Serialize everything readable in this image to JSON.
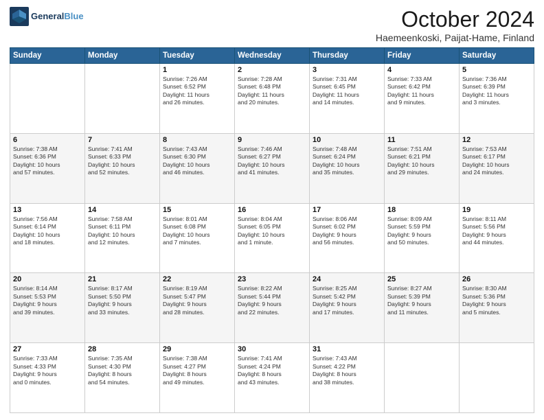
{
  "header": {
    "logo_line1": "General",
    "logo_line2": "Blue",
    "title": "October 2024",
    "subtitle": "Haemeenkoski, Paijat-Hame, Finland"
  },
  "weekdays": [
    "Sunday",
    "Monday",
    "Tuesday",
    "Wednesday",
    "Thursday",
    "Friday",
    "Saturday"
  ],
  "weeks": [
    [
      {
        "day": "",
        "info": ""
      },
      {
        "day": "",
        "info": ""
      },
      {
        "day": "1",
        "info": "Sunrise: 7:26 AM\nSunset: 6:52 PM\nDaylight: 11 hours\nand 26 minutes."
      },
      {
        "day": "2",
        "info": "Sunrise: 7:28 AM\nSunset: 6:48 PM\nDaylight: 11 hours\nand 20 minutes."
      },
      {
        "day": "3",
        "info": "Sunrise: 7:31 AM\nSunset: 6:45 PM\nDaylight: 11 hours\nand 14 minutes."
      },
      {
        "day": "4",
        "info": "Sunrise: 7:33 AM\nSunset: 6:42 PM\nDaylight: 11 hours\nand 9 minutes."
      },
      {
        "day": "5",
        "info": "Sunrise: 7:36 AM\nSunset: 6:39 PM\nDaylight: 11 hours\nand 3 minutes."
      }
    ],
    [
      {
        "day": "6",
        "info": "Sunrise: 7:38 AM\nSunset: 6:36 PM\nDaylight: 10 hours\nand 57 minutes."
      },
      {
        "day": "7",
        "info": "Sunrise: 7:41 AM\nSunset: 6:33 PM\nDaylight: 10 hours\nand 52 minutes."
      },
      {
        "day": "8",
        "info": "Sunrise: 7:43 AM\nSunset: 6:30 PM\nDaylight: 10 hours\nand 46 minutes."
      },
      {
        "day": "9",
        "info": "Sunrise: 7:46 AM\nSunset: 6:27 PM\nDaylight: 10 hours\nand 41 minutes."
      },
      {
        "day": "10",
        "info": "Sunrise: 7:48 AM\nSunset: 6:24 PM\nDaylight: 10 hours\nand 35 minutes."
      },
      {
        "day": "11",
        "info": "Sunrise: 7:51 AM\nSunset: 6:21 PM\nDaylight: 10 hours\nand 29 minutes."
      },
      {
        "day": "12",
        "info": "Sunrise: 7:53 AM\nSunset: 6:17 PM\nDaylight: 10 hours\nand 24 minutes."
      }
    ],
    [
      {
        "day": "13",
        "info": "Sunrise: 7:56 AM\nSunset: 6:14 PM\nDaylight: 10 hours\nand 18 minutes."
      },
      {
        "day": "14",
        "info": "Sunrise: 7:58 AM\nSunset: 6:11 PM\nDaylight: 10 hours\nand 12 minutes."
      },
      {
        "day": "15",
        "info": "Sunrise: 8:01 AM\nSunset: 6:08 PM\nDaylight: 10 hours\nand 7 minutes."
      },
      {
        "day": "16",
        "info": "Sunrise: 8:04 AM\nSunset: 6:05 PM\nDaylight: 10 hours\nand 1 minute."
      },
      {
        "day": "17",
        "info": "Sunrise: 8:06 AM\nSunset: 6:02 PM\nDaylight: 9 hours\nand 56 minutes."
      },
      {
        "day": "18",
        "info": "Sunrise: 8:09 AM\nSunset: 5:59 PM\nDaylight: 9 hours\nand 50 minutes."
      },
      {
        "day": "19",
        "info": "Sunrise: 8:11 AM\nSunset: 5:56 PM\nDaylight: 9 hours\nand 44 minutes."
      }
    ],
    [
      {
        "day": "20",
        "info": "Sunrise: 8:14 AM\nSunset: 5:53 PM\nDaylight: 9 hours\nand 39 minutes."
      },
      {
        "day": "21",
        "info": "Sunrise: 8:17 AM\nSunset: 5:50 PM\nDaylight: 9 hours\nand 33 minutes."
      },
      {
        "day": "22",
        "info": "Sunrise: 8:19 AM\nSunset: 5:47 PM\nDaylight: 9 hours\nand 28 minutes."
      },
      {
        "day": "23",
        "info": "Sunrise: 8:22 AM\nSunset: 5:44 PM\nDaylight: 9 hours\nand 22 minutes."
      },
      {
        "day": "24",
        "info": "Sunrise: 8:25 AM\nSunset: 5:42 PM\nDaylight: 9 hours\nand 17 minutes."
      },
      {
        "day": "25",
        "info": "Sunrise: 8:27 AM\nSunset: 5:39 PM\nDaylight: 9 hours\nand 11 minutes."
      },
      {
        "day": "26",
        "info": "Sunrise: 8:30 AM\nSunset: 5:36 PM\nDaylight: 9 hours\nand 5 minutes."
      }
    ],
    [
      {
        "day": "27",
        "info": "Sunrise: 7:33 AM\nSunset: 4:33 PM\nDaylight: 9 hours\nand 0 minutes."
      },
      {
        "day": "28",
        "info": "Sunrise: 7:35 AM\nSunset: 4:30 PM\nDaylight: 8 hours\nand 54 minutes."
      },
      {
        "day": "29",
        "info": "Sunrise: 7:38 AM\nSunset: 4:27 PM\nDaylight: 8 hours\nand 49 minutes."
      },
      {
        "day": "30",
        "info": "Sunrise: 7:41 AM\nSunset: 4:24 PM\nDaylight: 8 hours\nand 43 minutes."
      },
      {
        "day": "31",
        "info": "Sunrise: 7:43 AM\nSunset: 4:22 PM\nDaylight: 8 hours\nand 38 minutes."
      },
      {
        "day": "",
        "info": ""
      },
      {
        "day": "",
        "info": ""
      }
    ]
  ]
}
